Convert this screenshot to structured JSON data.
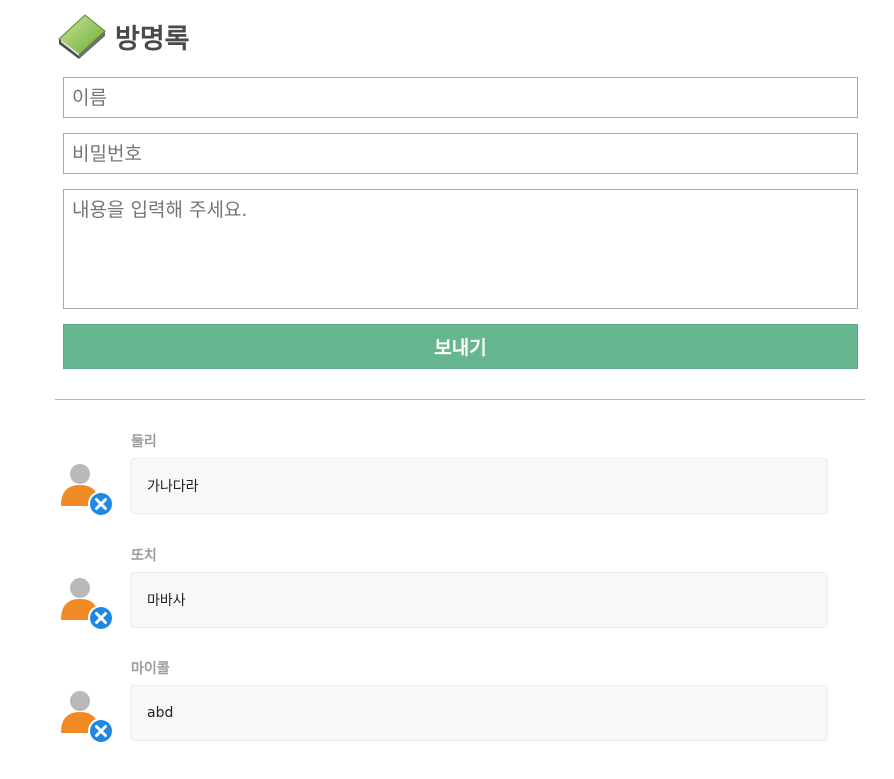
{
  "header": {
    "title": "방명록",
    "icon": "guestbook-book-icon"
  },
  "form": {
    "name_placeholder": "이름",
    "password_placeholder": "비밀번호",
    "content_placeholder": "내용을 입력해 주세요.",
    "submit_label": "보내기"
  },
  "colors": {
    "accent": "#66b78f",
    "avatar_body": "#f08a24",
    "avatar_head": "#b9b9b9",
    "delete_badge": "#1e88e5"
  },
  "entries": [
    {
      "author": "둘리",
      "message": "가나다라"
    },
    {
      "author": "또치",
      "message": "마바사"
    },
    {
      "author": "마이콜",
      "message": "abd"
    }
  ]
}
